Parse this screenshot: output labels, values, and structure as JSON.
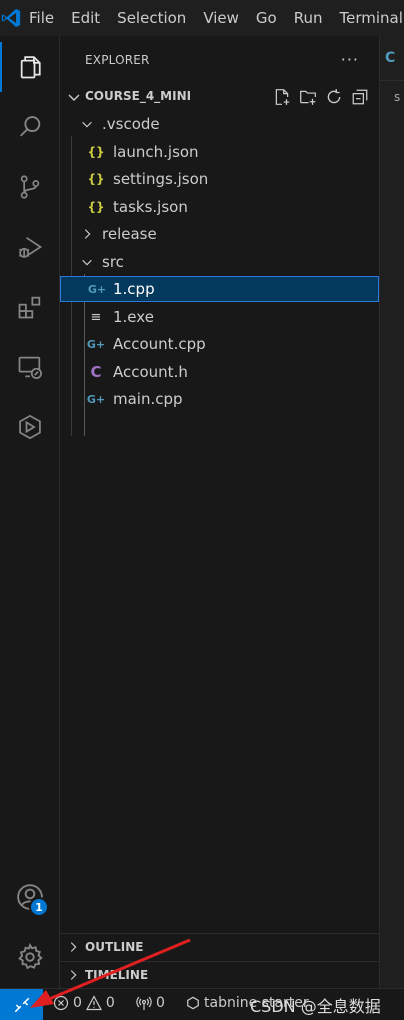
{
  "menubar": {
    "items": [
      "File",
      "Edit",
      "Selection",
      "View",
      "Go",
      "Run",
      "Terminal"
    ]
  },
  "activity_bar": {
    "items": [
      "explorer",
      "search",
      "source-control",
      "run-and-debug",
      "extensions",
      "remote-explorer",
      "codeium"
    ],
    "account_badge": "1"
  },
  "sidebar": {
    "title": "EXPLORER",
    "more": "···",
    "workspace": "COURSE_4_MINI",
    "tree": [
      {
        "label": ".vscode",
        "kind": "folder",
        "expanded": true,
        "icon": "{}"
      },
      {
        "label": "launch.json",
        "kind": "json",
        "icon": "{}"
      },
      {
        "label": "settings.json",
        "kind": "json",
        "icon": "{}"
      },
      {
        "label": "tasks.json",
        "kind": "json",
        "icon": "{}"
      },
      {
        "label": "release",
        "kind": "folder",
        "expanded": false
      },
      {
        "label": "src",
        "kind": "folder",
        "expanded": true
      },
      {
        "label": "1.cpp",
        "kind": "cpp",
        "icon": "G+",
        "selected": true
      },
      {
        "label": "1.exe",
        "kind": "exe",
        "icon": "≡"
      },
      {
        "label": "Account.cpp",
        "kind": "cpp",
        "icon": "G+"
      },
      {
        "label": "Account.h",
        "kind": "h",
        "icon": "C"
      },
      {
        "label": "main.cpp",
        "kind": "cpp",
        "icon": "G+"
      }
    ],
    "sections": [
      "OUTLINE",
      "TIMELINE"
    ]
  },
  "editor": {
    "tab_stub": "C",
    "crumb_stub": "s"
  },
  "statusbar": {
    "errors": "0",
    "warnings": "0",
    "ports": "0",
    "tabnine": "tabnine starter",
    "watermark": "CSDN @全息数据"
  },
  "colors": {
    "accent": "#0078d4",
    "json_icon": "#cbcb41",
    "cpp_icon": "#519aba",
    "h_icon": "#a074c4",
    "selection_bg": "#04395e",
    "selection_border": "#2b79d8",
    "annotation_arrow": "#e02020"
  }
}
